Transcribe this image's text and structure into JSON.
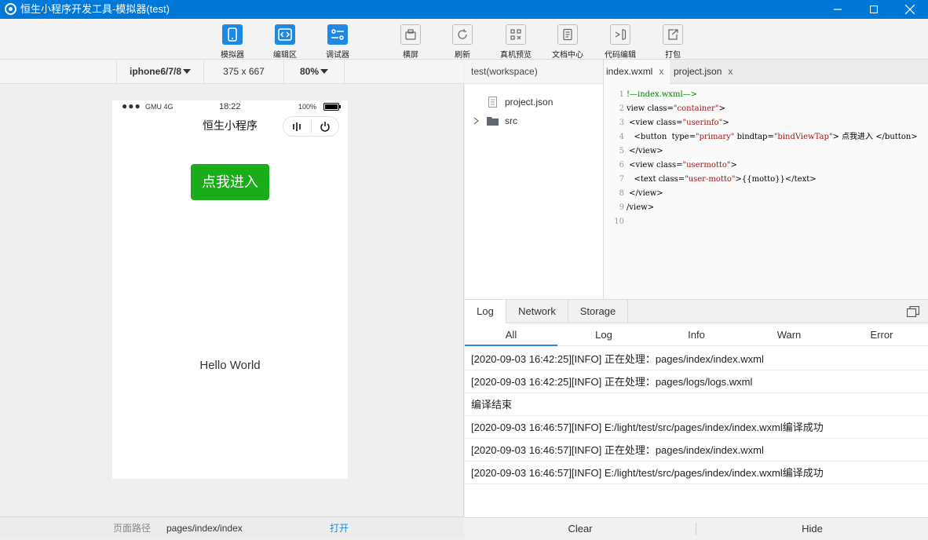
{
  "window": {
    "title": "恒生小程序开发工具-模拟器(test)",
    "controls": [
      "minimize",
      "maximize",
      "close"
    ]
  },
  "toolbar": {
    "tools": [
      {
        "label": "模拟器",
        "icon": "phone-icon"
      },
      {
        "label": "编辑区",
        "icon": "code-icon"
      },
      {
        "label": "调试器",
        "icon": "debug-icon"
      },
      {
        "label": "横屏",
        "icon": "rotate-icon"
      },
      {
        "label": "刷新",
        "icon": "refresh-icon"
      },
      {
        "label": "真机预览",
        "icon": "qrcode-icon"
      },
      {
        "label": "文档中心",
        "icon": "document-icon"
      },
      {
        "label": "代码编辑",
        "icon": "vscode-icon"
      },
      {
        "label": "打包",
        "icon": "export-icon"
      }
    ]
  },
  "device": {
    "model": "iphone6/7/8",
    "resolution": "375 x 667",
    "zoom": "80%"
  },
  "phone": {
    "signal": "●●●",
    "carrier": "GMU 4G",
    "time": "18:22",
    "battery": "100%",
    "nav_title": "恒生小程序",
    "button_label": "点我进入",
    "motto": "Hello World"
  },
  "pathbar": {
    "label": "页面路径",
    "path": "pages/index/index",
    "open_link": "打开"
  },
  "explorer": {
    "workspace": "test(workspace)",
    "items": [
      {
        "name": "project.json",
        "type": "file"
      },
      {
        "name": "src",
        "type": "folder"
      }
    ]
  },
  "editor": {
    "tabs": [
      {
        "label": "index.wxml",
        "close": "x"
      },
      {
        "label": "project.json",
        "close": "x"
      }
    ],
    "lines": [
      {
        "n": "1",
        "parts": [
          [
            "c",
            "!—index.wxml—>"
          ]
        ]
      },
      {
        "n": "2",
        "parts": [
          [
            "t",
            "view class="
          ],
          [
            "s",
            "\"container\""
          ],
          [
            "t",
            ">"
          ]
        ]
      },
      {
        "n": "3",
        "parts": [
          [
            "t",
            " <view class="
          ],
          [
            "s",
            "\"userinfo\""
          ],
          [
            "t",
            ">"
          ]
        ]
      },
      {
        "n": "4",
        "parts": [
          [
            "t",
            "   <button  type="
          ],
          [
            "s",
            "\"primary\""
          ],
          [
            "t",
            " bindtap="
          ],
          [
            "s",
            "\"bindViewTap\""
          ],
          [
            "t",
            "> 点我进入 </button>"
          ]
        ]
      },
      {
        "n": "5",
        "parts": [
          [
            "t",
            " </view>"
          ]
        ]
      },
      {
        "n": "6",
        "parts": [
          [
            "t",
            " <view class="
          ],
          [
            "s",
            "\"usermotto\""
          ],
          [
            "t",
            ">"
          ]
        ]
      },
      {
        "n": "7",
        "parts": [
          [
            "t",
            "   <text class="
          ],
          [
            "s",
            "\"user-motto\""
          ],
          [
            "t",
            ">{{motto}}</text>"
          ]
        ]
      },
      {
        "n": "8",
        "parts": [
          [
            "t",
            " </view>"
          ]
        ]
      },
      {
        "n": "9",
        "parts": [
          [
            "t",
            "/view>"
          ]
        ]
      },
      {
        "n": "10",
        "parts": []
      }
    ]
  },
  "console": {
    "tabs": [
      "Log",
      "Network",
      "Storage"
    ],
    "filters": [
      "All",
      "Log",
      "Info",
      "Warn",
      "Error"
    ],
    "logs": [
      "[2020-09-03 16:42:25][INFO] 正在处理：pages/index/index.wxml",
      "[2020-09-03 16:42:25][INFO] 正在处理：pages/logs/logs.wxml",
      "编译结束",
      "[2020-09-03 16:46:57][INFO] E:/light/test/src/pages/index/index.wxml编译成功",
      "[2020-09-03 16:46:57][INFO] 正在处理：pages/index/index.wxml",
      "[2020-09-03 16:46:57][INFO] E:/light/test/src/pages/index/index.wxml编译成功"
    ],
    "clear_label": "Clear",
    "hide_label": "Hide"
  },
  "colors": {
    "titlebar": "#0078d7",
    "accent_blue": "#1e88e5",
    "wechat_green": "#1aad19",
    "link": "#1e88e5"
  }
}
